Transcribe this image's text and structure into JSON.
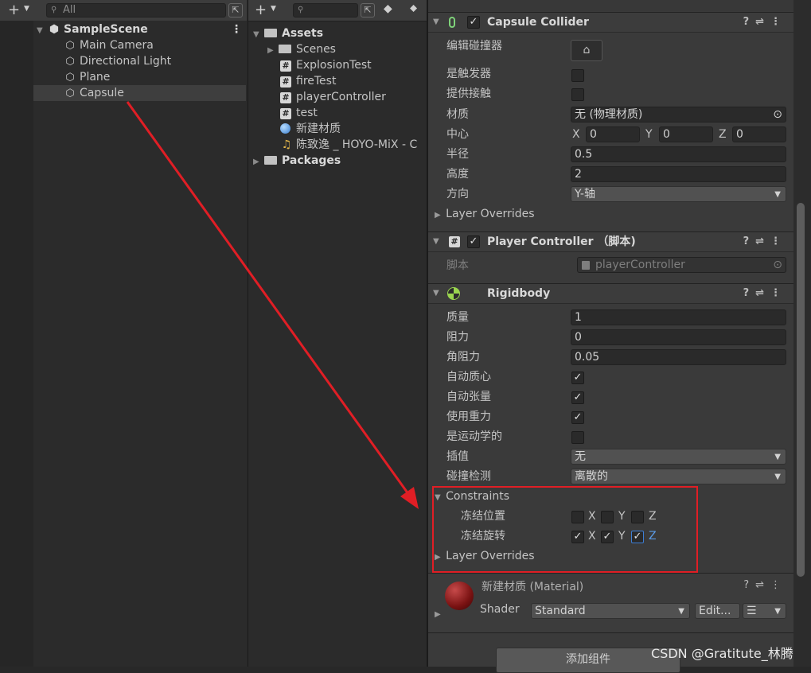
{
  "hierarchy": {
    "search_placeholder": "All",
    "scene": "SampleScene",
    "items": [
      "Main Camera",
      "Directional Light",
      "Plane",
      "Capsule"
    ]
  },
  "project": {
    "assets_label": "Assets",
    "items": [
      "Scenes",
      "ExplosionTest",
      "fireTest",
      "playerController",
      "test",
      "新建材质",
      "陈致逸 _ HOYO-MiX - C"
    ],
    "packages_label": "Packages"
  },
  "capsule_collider": {
    "title": "Capsule Collider",
    "edit_label": "编辑碰撞器",
    "is_trigger_label": "是触发器",
    "provides_contacts_label": "提供接触",
    "material_label": "材质",
    "material_value": "无 (物理材质)",
    "center_label": "中心",
    "center": {
      "x": "0",
      "y": "0",
      "z": "0"
    },
    "radius_label": "半径",
    "radius": "0.5",
    "height_label": "高度",
    "height": "2",
    "direction_label": "方向",
    "direction": "Y-轴",
    "layer_overrides": "Layer Overrides"
  },
  "player_controller": {
    "title": "Player Controller （脚本)",
    "script_label": "脚本",
    "script_value": "playerController"
  },
  "rigidbody": {
    "title": "Rigidbody",
    "mass_label": "质量",
    "mass": "1",
    "drag_label": "阻力",
    "drag": "0",
    "angular_drag_label": "角阻力",
    "angular_drag": "0.05",
    "auto_com_label": "自动质心",
    "auto_tensor_label": "自动张量",
    "use_gravity_label": "使用重力",
    "kinematic_label": "是运动学的",
    "interpolate_label": "插值",
    "interpolate": "无",
    "collision_label": "碰撞检测",
    "collision": "离散的",
    "constraints_label": "Constraints",
    "freeze_pos_label": "冻结位置",
    "freeze_rot_label": "冻结旋转",
    "axes": {
      "x": "X",
      "y": "Y",
      "z": "Z"
    },
    "layer_overrides": "Layer Overrides"
  },
  "material": {
    "title": "新建材质 (Material)",
    "shader_label": "Shader",
    "shader_value": "Standard",
    "edit_button": "Edit...",
    "add_component": "添加组件"
  },
  "axis_labels": {
    "x": "X",
    "y": "Y",
    "z": "Z"
  },
  "watermark": "CSDN @Gratitute_林腾",
  "colors": {
    "annotation": "#e01e25",
    "check_blue": "#3d7fd6"
  }
}
